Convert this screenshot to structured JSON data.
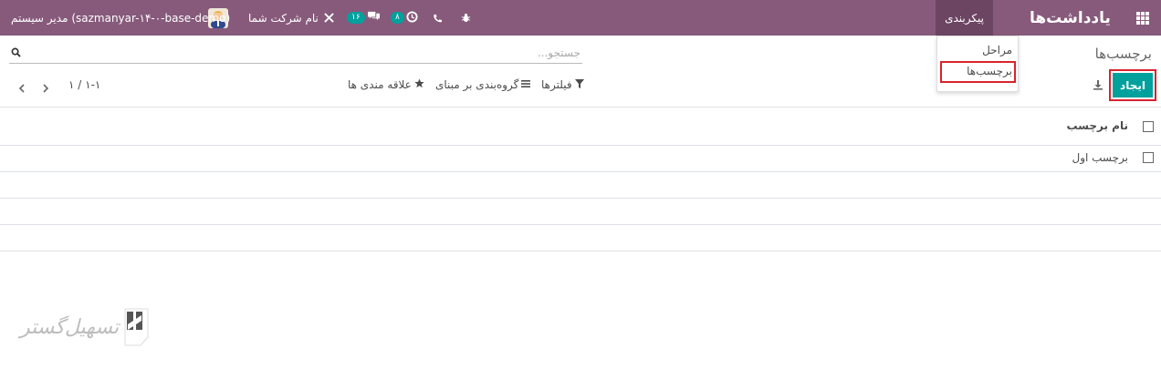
{
  "navbar": {
    "app_name": "یادداشت‌ها",
    "menu_config": "پیکربندی",
    "company": "نام شرکت شما",
    "user": "مدیر سیستم (sazmanyar-۱۴-۰-base-demo)",
    "activity_count": "۸",
    "messages_count": "۱۶"
  },
  "dropdown": {
    "items": [
      "مراحل",
      "برچسب‌ها"
    ]
  },
  "page": {
    "title": "برچسب‌ها"
  },
  "search": {
    "placeholder": "جستجو..."
  },
  "toolbar": {
    "create_label": "ایجاد",
    "filters_label": "فیلترها",
    "groupby_label": "گروه‌بندی بر مبنای",
    "favorites_label": "علاقه مندی ها",
    "pager": "۱-۱ / ۱"
  },
  "list": {
    "header": "نام برچسب",
    "rows": [
      "برچسب اول"
    ]
  },
  "watermark": {
    "text": "تسهیل‌گستر"
  },
  "colors": {
    "navbar": "#875a7b",
    "primary": "#00a09d",
    "highlight": "#d9232e"
  }
}
